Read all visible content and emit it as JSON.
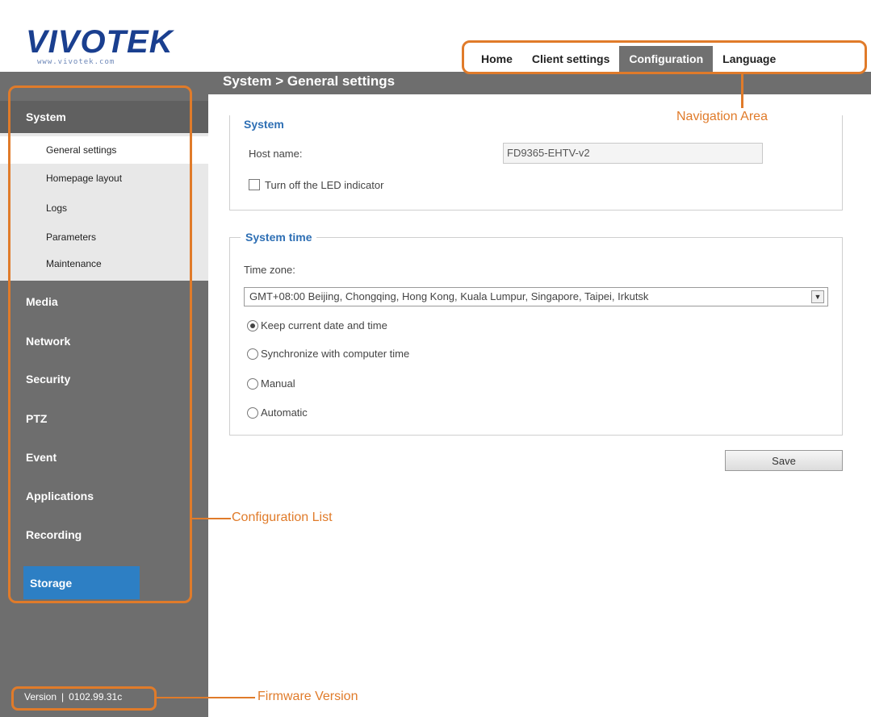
{
  "brand": {
    "logo_text": "VIVOTEK",
    "logo_sub": "www.vivotek.com"
  },
  "nav": {
    "items": [
      "Home",
      "Client settings",
      "Configuration",
      "Language"
    ],
    "active": "Configuration"
  },
  "header": {
    "breadcrumb": "System  > General settings"
  },
  "sidebar": {
    "categories": [
      "System",
      "Media",
      "Network",
      "Security",
      "PTZ",
      "Event",
      "Applications",
      "Recording"
    ],
    "system_subitems": [
      "General settings",
      "Homepage layout",
      "Logs",
      "Parameters",
      "Maintenance"
    ],
    "active_subitem": "General settings",
    "storage_label": "Storage",
    "version_label": "Version",
    "version_value": "0102.99.31c"
  },
  "system_section": {
    "legend": "System",
    "host_name_label": "Host name:",
    "host_name_value": "FD9365-EHTV-v2",
    "led_checkbox_label": "Turn off the LED indicator",
    "led_checkbox_checked": false
  },
  "time_section": {
    "legend": "System time",
    "time_zone_label": "Time zone:",
    "time_zone_value": "GMT+08:00 Beijing, Chongqing, Hong Kong, Kuala Lumpur, Singapore, Taipei, Irkutsk",
    "options": [
      "Keep current date and time",
      "Synchronize with computer time",
      "Manual",
      "Automatic"
    ],
    "selected_option": "Keep current date and time"
  },
  "save_label": "Save",
  "annotations": {
    "navigation": "Navigation Area",
    "config_list": "Configuration List",
    "firmware": "Firmware Version"
  },
  "colors": {
    "accent": "#e07b2a",
    "sidebar": "#6e6e6e",
    "storage": "#2d7fc4",
    "legend": "#2e6fb4"
  }
}
